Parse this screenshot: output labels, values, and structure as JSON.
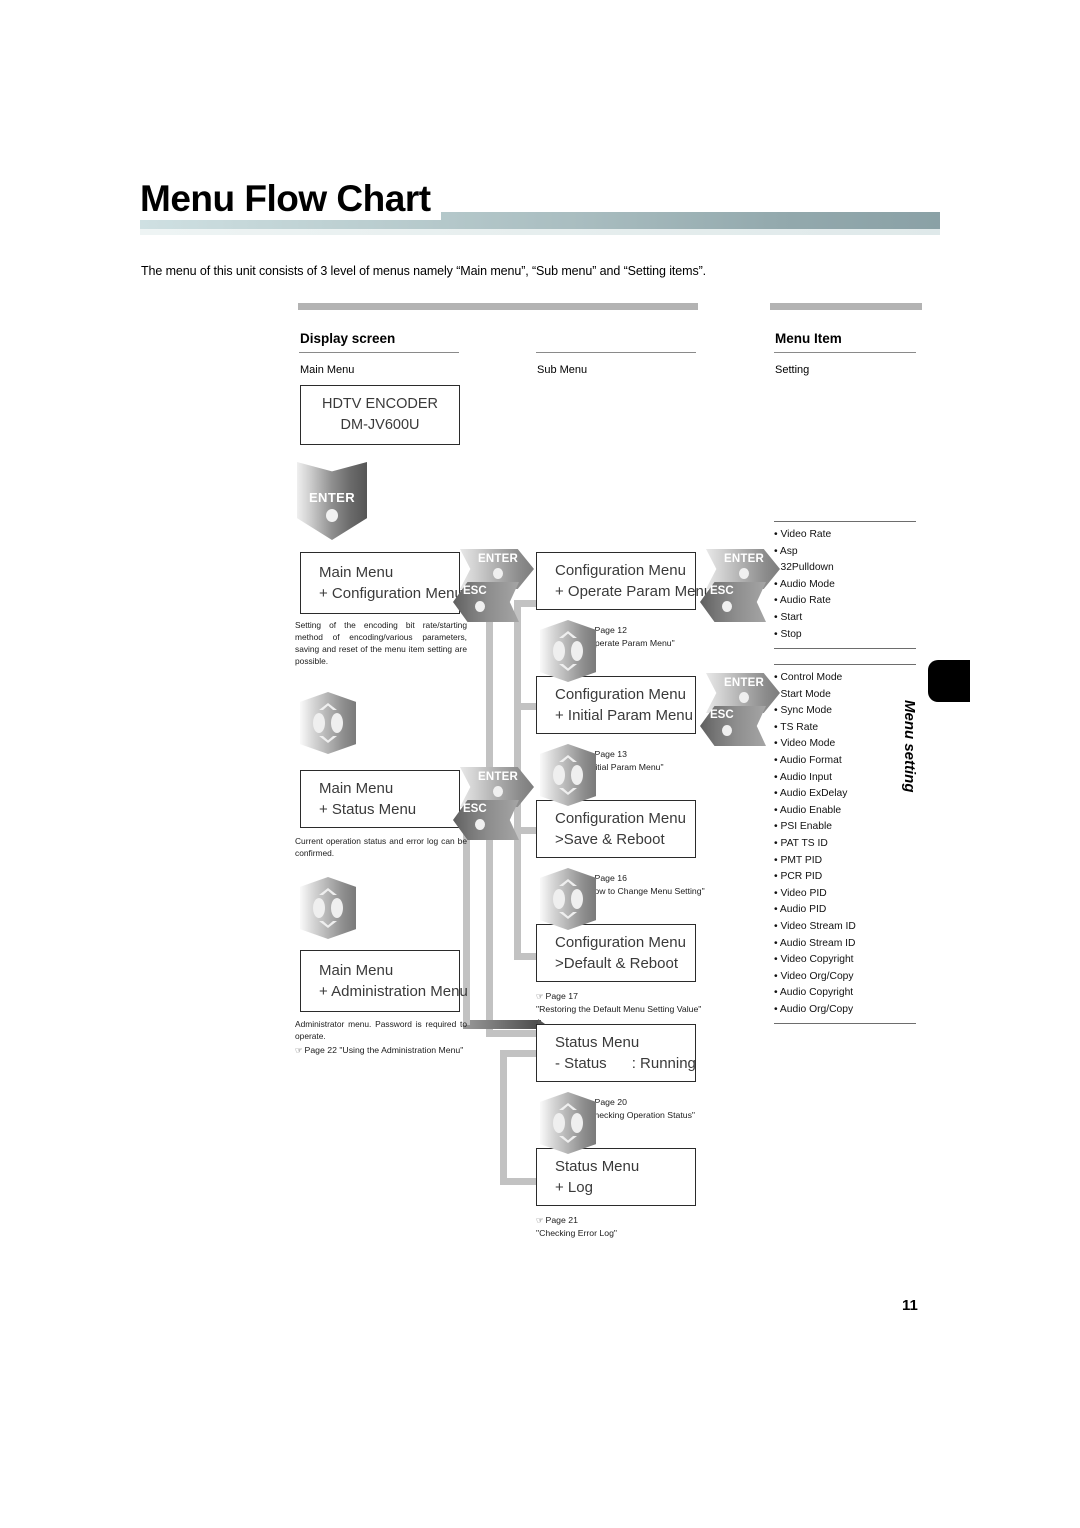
{
  "page": {
    "title": "Menu Flow Chart",
    "intro": "The menu of this unit consists of 3 level of menus namely “Main menu”, “Sub menu” and “Setting items”.",
    "number": "11",
    "side_tab_label": "Menu setting"
  },
  "columns": {
    "display_screen": {
      "heading": "Display screen",
      "sub": "Main Menu"
    },
    "sub_menu": {
      "heading": "",
      "sub": "Sub Menu"
    },
    "menu_item": {
      "heading": "Menu Item",
      "sub": "Setting"
    }
  },
  "device": {
    "line1": "HDTV ENCODER",
    "line2": "DM-JV600U"
  },
  "buttons": {
    "enter": "ENTER",
    "esc": "ESC"
  },
  "main_menus": [
    {
      "line1": "Main Menu",
      "line2": "+ Configuration Menu",
      "desc": "Setting of the encoding bit rate/starting method of encoding/various parameters, saving and reset of the menu item setting are possible."
    },
    {
      "line1": "Main Menu",
      "line2": "+ Status Menu",
      "desc": "Current operation status and error log can be confirmed."
    },
    {
      "line1": "Main Menu",
      "line2": "+ Administration Menu",
      "desc": "Administrator menu. Password is required to operate.",
      "ref_page": "Page 22",
      "ref_title": "\"Using the Administration Menu\""
    }
  ],
  "sub_menus": [
    {
      "line1": "Configuration Menu",
      "line2": "+ Operate Param Menu",
      "ref_page": "Page 12",
      "ref_title": "\"Operate Param Menu\""
    },
    {
      "line1": "Configuration Menu",
      "line2": "+ Initial Param Menu",
      "ref_page": "Page 13",
      "ref_title": "\"Initial Param Menu\""
    },
    {
      "line1": "Configuration Menu",
      "line2": ">Save & Reboot",
      "ref_page": "Page 16",
      "ref_title": "\"How to Change Menu Setting\""
    },
    {
      "line1": "Configuration Menu",
      "line2": ">Default & Reboot",
      "ref_page": "Page 17",
      "ref_title": "\"Restoring the Default Menu Setting Value\""
    },
    {
      "line1": "Status Menu",
      "line2": "- Status      : Running",
      "ref_page": "Page 20",
      "ref_title": "\"Checking Operation Status\""
    },
    {
      "line1": "Status Menu",
      "line2": "+ Log",
      "ref_page": "Page 21",
      "ref_title": "\"Checking Error Log\""
    }
  ],
  "setting_groups": [
    {
      "items": [
        "• Video Rate",
        "• Asp",
        "• 32Pulldown",
        "• Audio Mode",
        "• Audio Rate",
        "• Start",
        "• Stop"
      ]
    },
    {
      "items": [
        "• Control Mode",
        "• Start Mode",
        "• Sync Mode",
        "• TS Rate",
        "• Video Mode",
        "• Audio Format",
        "• Audio Input",
        "• Audio ExDelay",
        "• Audio Enable",
        "• PSI Enable",
        "• PAT TS ID",
        "• PMT PID",
        "• PCR PID",
        "• Video PID",
        "• Audio PID",
        "• Video Stream ID",
        "• Audio Stream ID",
        "• Video Copyright",
        "• Video Org/Copy",
        "• Audio Copyright",
        "• Audio Org/Copy"
      ]
    }
  ]
}
